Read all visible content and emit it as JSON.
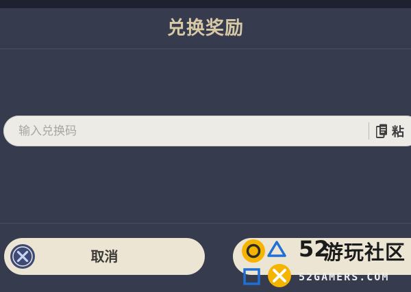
{
  "dialog": {
    "title": "兑换奖励"
  },
  "code_input": {
    "placeholder": "输入兑换码",
    "value": ""
  },
  "paste": {
    "label": "粘",
    "icon": "clipboard-icon"
  },
  "buttons": {
    "cancel_label": "取消",
    "cancel_icon": "close-circle-icon",
    "confirm_label": ""
  },
  "watermark": {
    "number": "52",
    "name": "游玩社区",
    "site": "52GAMERS.COM",
    "icon": "playstation-buttons-icon"
  },
  "colors": {
    "background": "#363b4e",
    "title": "#d8c9a6",
    "button": "#ece5d3",
    "input": "#ecebe6",
    "cancel_icon": "#3d4a78",
    "watermark_accent": "#f5b400"
  }
}
